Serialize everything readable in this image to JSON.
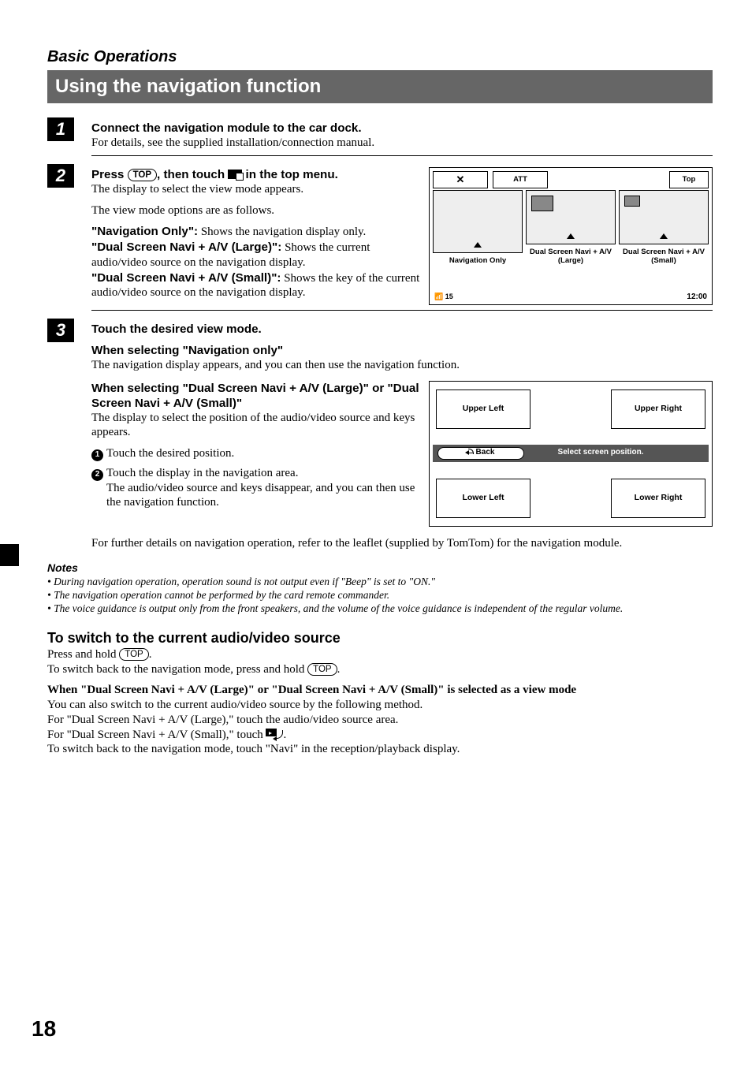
{
  "chapter": "Basic Operations",
  "page_title": "Using the navigation function",
  "page_number": "18",
  "steps": {
    "s1": {
      "num": "1",
      "heading": "Connect the navigation module to the car dock.",
      "body": "For details, see the supplied installation/connection manual."
    },
    "s2": {
      "num": "2",
      "heading_pre": "Press ",
      "heading_key": "TOP",
      "heading_mid": ", then touch ",
      "heading_post": " in the top menu.",
      "line1": "The display to select the view mode appears.",
      "line2": "The view mode options are as follows.",
      "opt1_label": "\"Navigation Only\":",
      "opt1_text": " Shows the navigation display only.",
      "opt2_label": "\"Dual Screen Navi + A/V (Large)\":",
      "opt2_text": " Shows the current audio/video source on the navigation display.",
      "opt3_label": "\"Dual Screen Navi + A/V (Small)\":",
      "opt3_text": " Shows the key of the current audio/video source on the navigation display."
    },
    "s3": {
      "num": "3",
      "heading": "Touch the desired view mode.",
      "sub1_head": "When selecting \"Navigation only\"",
      "sub1_text": "The navigation display appears, and you can then use the navigation function.",
      "sub2_head": "When selecting \"Dual Screen Navi + A/V (Large)\" or \"Dual Screen Navi + A/V (Small)\"",
      "sub2_text": "The display to select the position of the audio/video source and keys appears.",
      "bullet1": "Touch the desired position.",
      "bullet2a": "Touch the display in the navigation area.",
      "bullet2b": "The audio/video source and keys disappear, and you can then use the navigation function.",
      "closing": "For further details on navigation operation, refer to the leaflet (supplied by TomTom) for the navigation module."
    }
  },
  "illus1": {
    "close_glyph": "✕",
    "att_label": "ATT",
    "top_label": "Top",
    "mode1": "Navigation Only",
    "mode2": "Dual Screen Navi + A/V (Large)",
    "mode3": "Dual Screen Navi + A/V (Small)",
    "signal": "15",
    "time": "12:00"
  },
  "illus2": {
    "ul": "Upper Left",
    "ur": "Upper Right",
    "ll": "Lower Left",
    "lr": "Lower Right",
    "back": "Back",
    "msg": "Select screen position."
  },
  "notes_head": "Notes",
  "notes": {
    "n1": "During navigation operation, operation sound is not output even if \"Beep\" is set to \"ON.\"",
    "n2": "The navigation operation cannot be performed by the card remote commander.",
    "n3": "The voice guidance is output only from the front speakers, and the volume of the voice guidance is independent of the regular volume."
  },
  "switch": {
    "head": "To switch to the current audio/video source",
    "line1_pre": "Press and hold ",
    "line1_key": "TOP",
    "line1_post": ".",
    "line2_pre": "To switch back to the navigation mode, press and hold ",
    "line2_key": "TOP",
    "line2_post": ".",
    "sub_head": "When \"Dual Screen Navi + A/V (Large)\" or \"Dual Screen Navi + A/V (Small)\" is selected as a view mode",
    "line3": "You can also switch to the current audio/video source by the following method.",
    "line4": "For \"Dual Screen Navi + A/V (Large),\" touch the audio/video source area.",
    "line5_pre": "For \"Dual Screen Navi + A/V (Small),\" touch ",
    "line5_post": ".",
    "line6": "To switch back to the navigation mode, touch \"Navi\" in the reception/playback display."
  }
}
